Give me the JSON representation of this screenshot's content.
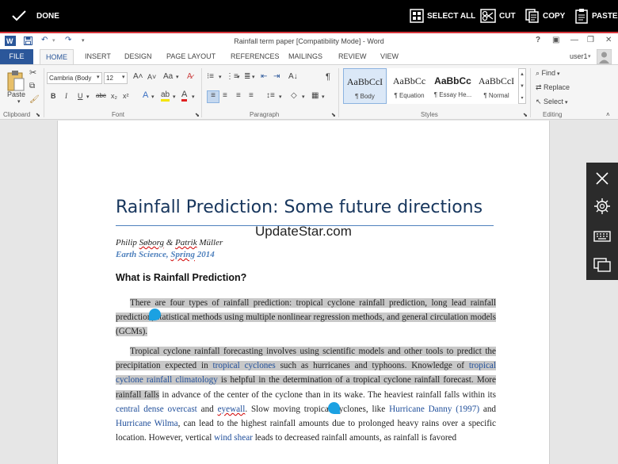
{
  "selection_bar": {
    "done": "DONE",
    "select_all": "SELECT ALL",
    "cut": "CUT",
    "copy": "COPY",
    "paste": "PASTE"
  },
  "window": {
    "title": "Rainfall term paper [Compatibility Mode] - Word",
    "user": "user1",
    "help": "?"
  },
  "tabs": [
    "FILE",
    "HOME",
    "INSERT",
    "DESIGN",
    "PAGE LAYOUT",
    "REFERENCES",
    "MAILINGS",
    "REVIEW",
    "VIEW"
  ],
  "ribbon": {
    "paste_label": "Paste",
    "font_name": "Cambria (Body",
    "font_size": "12",
    "aa_label": "Aa",
    "groups": {
      "clipboard": "Clipboard",
      "font": "Font",
      "paragraph": "Paragraph",
      "styles": "Styles",
      "editing": "Editing"
    },
    "styles": [
      {
        "preview": "AaBbCcI",
        "name": "¶ Body"
      },
      {
        "preview": "AaBbCc",
        "name": "¶ Equation"
      },
      {
        "preview": "AaBbCc",
        "name": "¶ Essay He..."
      },
      {
        "preview": "AaBbCcI",
        "name": "¶ Normal"
      }
    ],
    "find": "Find",
    "replace": "Replace",
    "select": "Select"
  },
  "document": {
    "title": "Rainfall Prediction: Some future directions",
    "watermark": "UpdateStar.com",
    "authors": {
      "a1": "Philip ",
      "a1b": "Søborg",
      "amp": " & ",
      "a2": "Patrik",
      "a2b": " Müller"
    },
    "journal": {
      "pre": "Earth Science, ",
      "month": "Spring",
      "year": " 2014"
    },
    "heading": "What is Rainfall Prediction?",
    "p1": "There are four types of rainfall prediction: tropical cyclone rainfall prediction, long lead rainfall prediction, statistical methods using multiple nonlinear regression methods, and general circulation models (GCMs).",
    "p2": {
      "s1": "Tropical cyclone rainfall forecasting involves using scientific models and other tools to predict the precipitation expected in ",
      "l1": "tropical cyclones",
      "s2": " such as hurricanes and typhoons. Knowledge of ",
      "l2": "tropical cyclone rainfall climatology",
      "s3": " is helpful in the determination of a tropical cyclone rainfall forecast. More rainfall falls",
      "s4": " in advance of the center of the cyclone than in its wake. The heaviest rainfall falls within its ",
      "l3": "central dense overcast",
      "s5": " and ",
      "l4": "eyewall",
      "s6": ". Slow moving tropical cyclones, like ",
      "l5": "Hurricane Danny (1997)",
      "s7": " and ",
      "l6": "Hurricane Wilma",
      "s8": ", can lead to the highest rainfall amounts due to prolonged heavy rains over a specific location. However, vertical ",
      "l7": "wind shear",
      "s9": " leads to decreased rainfall amounts, as rainfall is favored"
    }
  }
}
